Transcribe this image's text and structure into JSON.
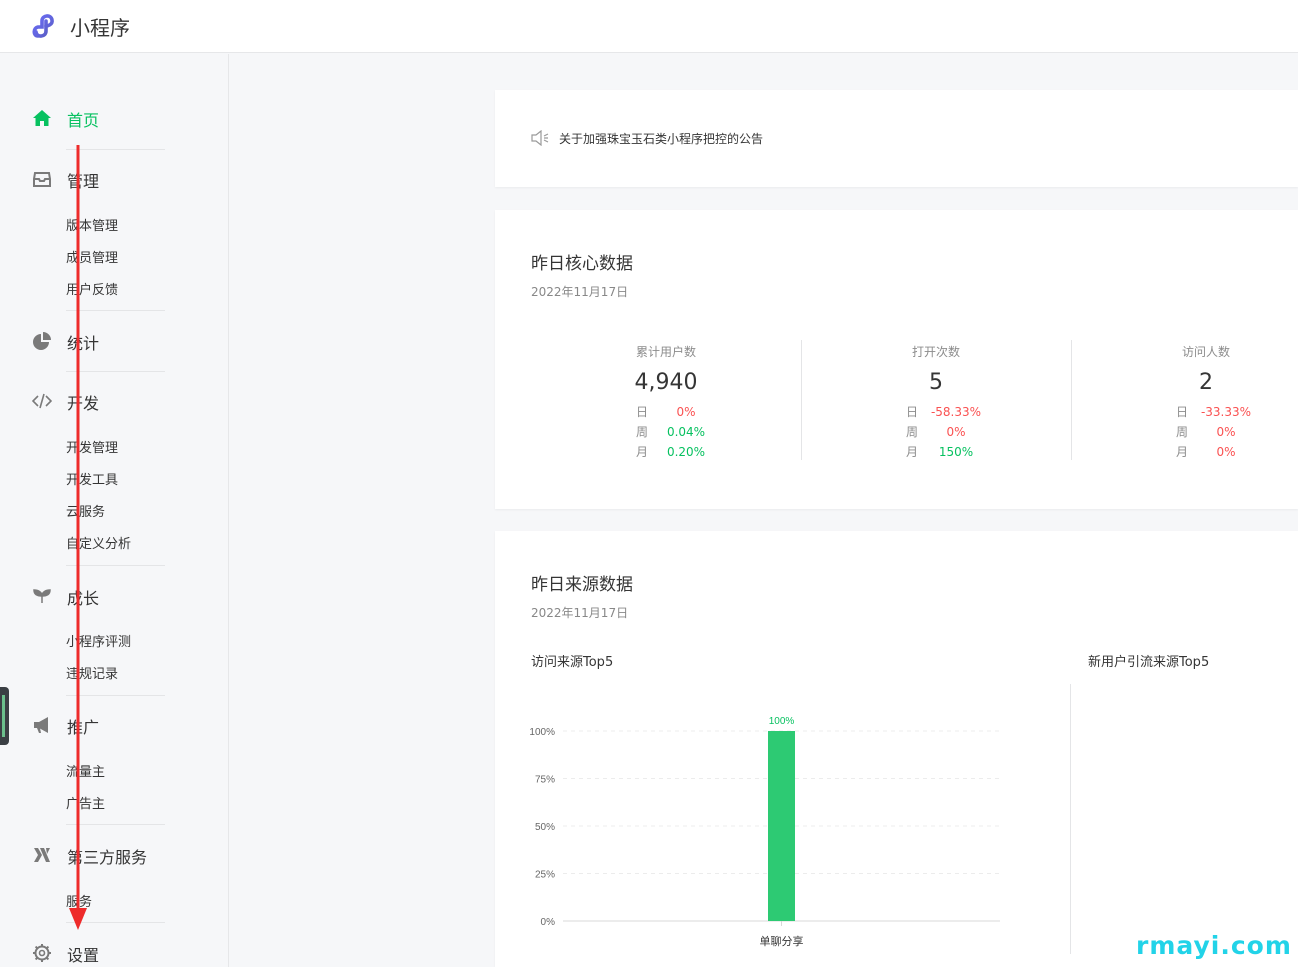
{
  "app": {
    "title": "小程序",
    "logo_icon": "miniprogram-logo-icon",
    "accent": "#07c160"
  },
  "sidebar": {
    "items": [
      {
        "label": "首页",
        "icon": "home-icon",
        "active": true
      },
      {
        "label": "管理",
        "icon": "inbox-icon",
        "sub": [
          "版本管理",
          "成员管理",
          "用户反馈"
        ]
      },
      {
        "label": "统计",
        "icon": "pie-chart-icon"
      },
      {
        "label": "开发",
        "icon": "code-icon",
        "sub": [
          "开发管理",
          "开发工具",
          "云服务",
          "自定义分析"
        ]
      },
      {
        "label": "成长",
        "icon": "sprout-icon",
        "sub": [
          "小程序评测",
          "违规记录"
        ]
      },
      {
        "label": "推广",
        "icon": "megaphone-icon",
        "sub": [
          "流量主",
          "广告主"
        ]
      },
      {
        "label": "第三方服务",
        "icon": "third-party-icon",
        "sub": [
          "服务"
        ]
      },
      {
        "label": "设置",
        "icon": "gear-icon"
      }
    ]
  },
  "notice": {
    "text": "关于加强珠宝玉石类小程序把控的公告",
    "icon": "speaker-icon"
  },
  "core": {
    "title": "昨日核心数据",
    "date": "2022年11月17日",
    "stats": [
      {
        "label": "累计用户数",
        "value": "4,940",
        "rows": [
          {
            "k": "日",
            "v": "0%",
            "color": "#fa5151"
          },
          {
            "k": "周",
            "v": "0.04%",
            "color": "#07c160"
          },
          {
            "k": "月",
            "v": "0.20%",
            "color": "#07c160"
          }
        ]
      },
      {
        "label": "打开次数",
        "value": "5",
        "rows": [
          {
            "k": "日",
            "v": "-58.33%",
            "color": "#fa5151"
          },
          {
            "k": "周",
            "v": "0%",
            "color": "#fa5151"
          },
          {
            "k": "月",
            "v": "150%",
            "color": "#07c160"
          }
        ]
      },
      {
        "label": "访问人数",
        "value": "2",
        "rows": [
          {
            "k": "日",
            "v": "-33.33%",
            "color": "#fa5151"
          },
          {
            "k": "周",
            "v": "0%",
            "color": "#fa5151"
          },
          {
            "k": "月",
            "v": "0%",
            "color": "#fa5151"
          }
        ]
      }
    ]
  },
  "source": {
    "title": "昨日来源数据",
    "date": "2022年11月17日",
    "left_title": "访问来源Top5",
    "right_title": "新用户引流来源Top5"
  },
  "chart_data": {
    "type": "bar",
    "categories": [
      "单聊分享"
    ],
    "values": [
      100
    ],
    "data_labels": [
      "100%"
    ],
    "yticks": [
      "0%",
      "25%",
      "50%",
      "75%",
      "100%"
    ],
    "ylim": [
      0,
      100
    ],
    "grid": true,
    "bar_color": "#2dca73"
  },
  "watermark": "rmayi.com"
}
